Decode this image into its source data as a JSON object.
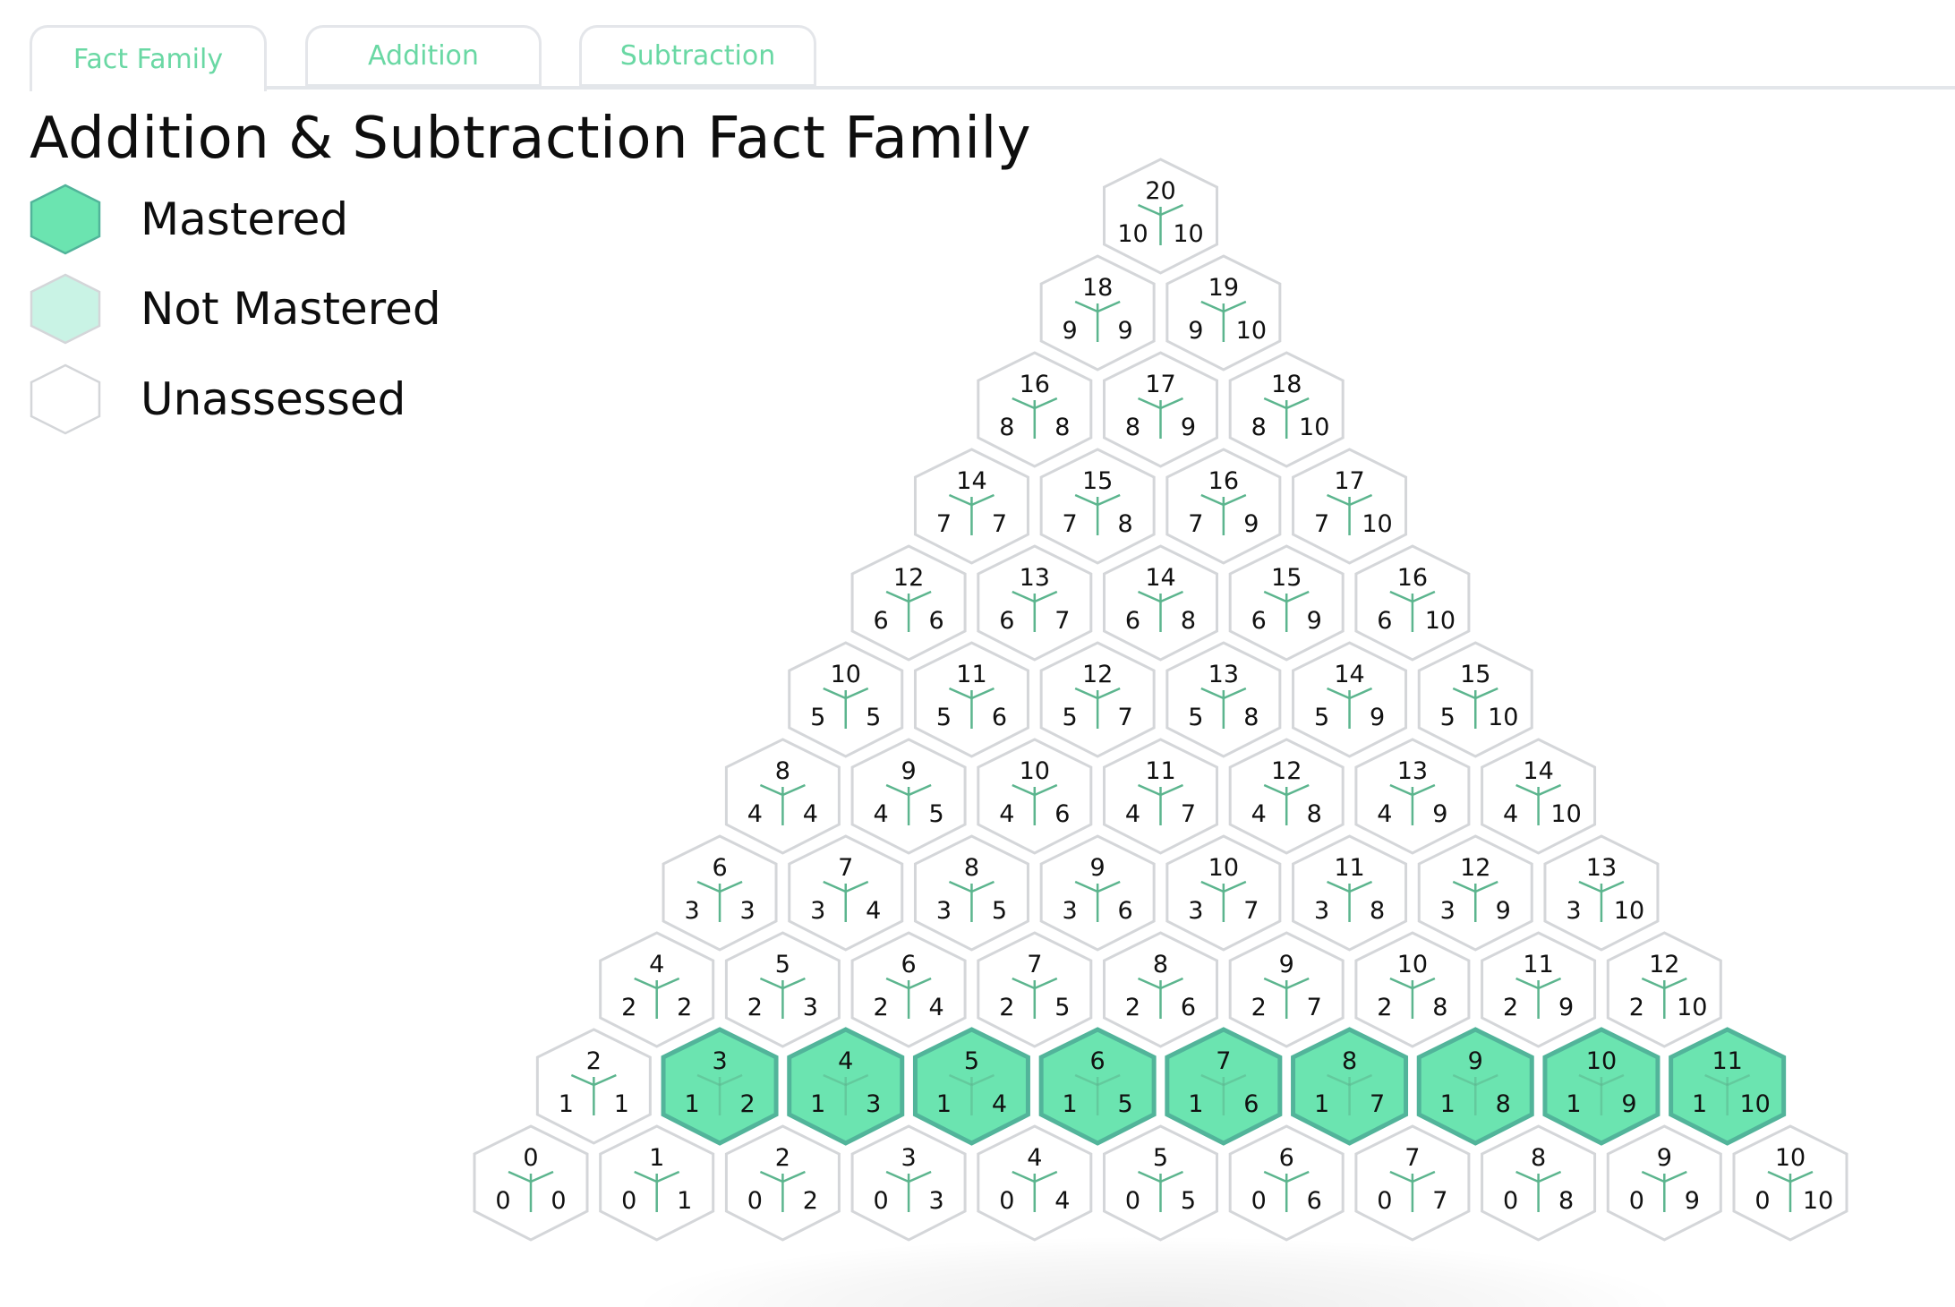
{
  "tabs": [
    {
      "label": "Fact Family",
      "active": true
    },
    {
      "label": "Addition",
      "active": false
    },
    {
      "label": "Subtraction",
      "active": false
    }
  ],
  "title": "Addition & Subtraction Fact Family",
  "legend": [
    {
      "status": "mastered",
      "label": "Mastered"
    },
    {
      "status": "not_mastered",
      "label": "Not Mastered"
    },
    {
      "status": "unassessed",
      "label": "Unassessed"
    }
  ],
  "colors": {
    "accent": "#6ad8a4",
    "mastered_fill": "#6be4b0",
    "mastered_stroke": "#52b49a",
    "not_mastered_fill": "#c9f3e5",
    "unassessed_fill": "#ffffff",
    "hex_stroke": "#d4d6d9",
    "branch_line": "#5cb58e",
    "tab_border": "#e4e6ea"
  },
  "fact_family": {
    "description": "Rows by first addend a (0 at bottom to 10 at top); each row contains b from a to 10; top value is a + b",
    "rows": [
      {
        "a": 0,
        "facts": [
          {
            "sum": 0,
            "a": 0,
            "b": 0,
            "status": "unassessed"
          },
          {
            "sum": 1,
            "a": 0,
            "b": 1,
            "status": "unassessed"
          },
          {
            "sum": 2,
            "a": 0,
            "b": 2,
            "status": "unassessed"
          },
          {
            "sum": 3,
            "a": 0,
            "b": 3,
            "status": "unassessed"
          },
          {
            "sum": 4,
            "a": 0,
            "b": 4,
            "status": "unassessed"
          },
          {
            "sum": 5,
            "a": 0,
            "b": 5,
            "status": "unassessed"
          },
          {
            "sum": 6,
            "a": 0,
            "b": 6,
            "status": "unassessed"
          },
          {
            "sum": 7,
            "a": 0,
            "b": 7,
            "status": "unassessed"
          },
          {
            "sum": 8,
            "a": 0,
            "b": 8,
            "status": "unassessed"
          },
          {
            "sum": 9,
            "a": 0,
            "b": 9,
            "status": "unassessed"
          },
          {
            "sum": 10,
            "a": 0,
            "b": 10,
            "status": "unassessed"
          }
        ]
      },
      {
        "a": 1,
        "facts": [
          {
            "sum": 2,
            "a": 1,
            "b": 1,
            "status": "unassessed"
          },
          {
            "sum": 3,
            "a": 1,
            "b": 2,
            "status": "mastered"
          },
          {
            "sum": 4,
            "a": 1,
            "b": 3,
            "status": "mastered"
          },
          {
            "sum": 5,
            "a": 1,
            "b": 4,
            "status": "mastered"
          },
          {
            "sum": 6,
            "a": 1,
            "b": 5,
            "status": "mastered"
          },
          {
            "sum": 7,
            "a": 1,
            "b": 6,
            "status": "mastered"
          },
          {
            "sum": 8,
            "a": 1,
            "b": 7,
            "status": "mastered"
          },
          {
            "sum": 9,
            "a": 1,
            "b": 8,
            "status": "mastered"
          },
          {
            "sum": 10,
            "a": 1,
            "b": 9,
            "status": "mastered"
          },
          {
            "sum": 11,
            "a": 1,
            "b": 10,
            "status": "mastered"
          }
        ]
      },
      {
        "a": 2,
        "facts": [
          {
            "sum": 4,
            "a": 2,
            "b": 2,
            "status": "unassessed"
          },
          {
            "sum": 5,
            "a": 2,
            "b": 3,
            "status": "unassessed"
          },
          {
            "sum": 6,
            "a": 2,
            "b": 4,
            "status": "unassessed"
          },
          {
            "sum": 7,
            "a": 2,
            "b": 5,
            "status": "unassessed"
          },
          {
            "sum": 8,
            "a": 2,
            "b": 6,
            "status": "unassessed"
          },
          {
            "sum": 9,
            "a": 2,
            "b": 7,
            "status": "unassessed"
          },
          {
            "sum": 10,
            "a": 2,
            "b": 8,
            "status": "unassessed"
          },
          {
            "sum": 11,
            "a": 2,
            "b": 9,
            "status": "unassessed"
          },
          {
            "sum": 12,
            "a": 2,
            "b": 10,
            "status": "unassessed"
          }
        ]
      },
      {
        "a": 3,
        "facts": [
          {
            "sum": 6,
            "a": 3,
            "b": 3,
            "status": "unassessed"
          },
          {
            "sum": 7,
            "a": 3,
            "b": 4,
            "status": "unassessed"
          },
          {
            "sum": 8,
            "a": 3,
            "b": 5,
            "status": "unassessed"
          },
          {
            "sum": 9,
            "a": 3,
            "b": 6,
            "status": "unassessed"
          },
          {
            "sum": 10,
            "a": 3,
            "b": 7,
            "status": "unassessed"
          },
          {
            "sum": 11,
            "a": 3,
            "b": 8,
            "status": "unassessed"
          },
          {
            "sum": 12,
            "a": 3,
            "b": 9,
            "status": "unassessed"
          },
          {
            "sum": 13,
            "a": 3,
            "b": 10,
            "status": "unassessed"
          }
        ]
      },
      {
        "a": 4,
        "facts": [
          {
            "sum": 8,
            "a": 4,
            "b": 4,
            "status": "unassessed"
          },
          {
            "sum": 9,
            "a": 4,
            "b": 5,
            "status": "unassessed"
          },
          {
            "sum": 10,
            "a": 4,
            "b": 6,
            "status": "unassessed"
          },
          {
            "sum": 11,
            "a": 4,
            "b": 7,
            "status": "unassessed"
          },
          {
            "sum": 12,
            "a": 4,
            "b": 8,
            "status": "unassessed"
          },
          {
            "sum": 13,
            "a": 4,
            "b": 9,
            "status": "unassessed"
          },
          {
            "sum": 14,
            "a": 4,
            "b": 10,
            "status": "unassessed"
          }
        ]
      },
      {
        "a": 5,
        "facts": [
          {
            "sum": 10,
            "a": 5,
            "b": 5,
            "status": "unassessed"
          },
          {
            "sum": 11,
            "a": 5,
            "b": 6,
            "status": "unassessed"
          },
          {
            "sum": 12,
            "a": 5,
            "b": 7,
            "status": "unassessed"
          },
          {
            "sum": 13,
            "a": 5,
            "b": 8,
            "status": "unassessed"
          },
          {
            "sum": 14,
            "a": 5,
            "b": 9,
            "status": "unassessed"
          },
          {
            "sum": 15,
            "a": 5,
            "b": 10,
            "status": "unassessed"
          }
        ]
      },
      {
        "a": 6,
        "facts": [
          {
            "sum": 12,
            "a": 6,
            "b": 6,
            "status": "unassessed"
          },
          {
            "sum": 13,
            "a": 6,
            "b": 7,
            "status": "unassessed"
          },
          {
            "sum": 14,
            "a": 6,
            "b": 8,
            "status": "unassessed"
          },
          {
            "sum": 15,
            "a": 6,
            "b": 9,
            "status": "unassessed"
          },
          {
            "sum": 16,
            "a": 6,
            "b": 10,
            "status": "unassessed"
          }
        ]
      },
      {
        "a": 7,
        "facts": [
          {
            "sum": 14,
            "a": 7,
            "b": 7,
            "status": "unassessed"
          },
          {
            "sum": 15,
            "a": 7,
            "b": 8,
            "status": "unassessed"
          },
          {
            "sum": 16,
            "a": 7,
            "b": 9,
            "status": "unassessed"
          },
          {
            "sum": 17,
            "a": 7,
            "b": 10,
            "status": "unassessed"
          }
        ]
      },
      {
        "a": 8,
        "facts": [
          {
            "sum": 16,
            "a": 8,
            "b": 8,
            "status": "unassessed"
          },
          {
            "sum": 17,
            "a": 8,
            "b": 9,
            "status": "unassessed"
          },
          {
            "sum": 18,
            "a": 8,
            "b": 10,
            "status": "unassessed"
          }
        ]
      },
      {
        "a": 9,
        "facts": [
          {
            "sum": 18,
            "a": 9,
            "b": 9,
            "status": "unassessed"
          },
          {
            "sum": 19,
            "a": 9,
            "b": 10,
            "status": "unassessed"
          }
        ]
      },
      {
        "a": 10,
        "facts": [
          {
            "sum": 20,
            "a": 10,
            "b": 10,
            "status": "unassessed"
          }
        ]
      }
    ]
  }
}
